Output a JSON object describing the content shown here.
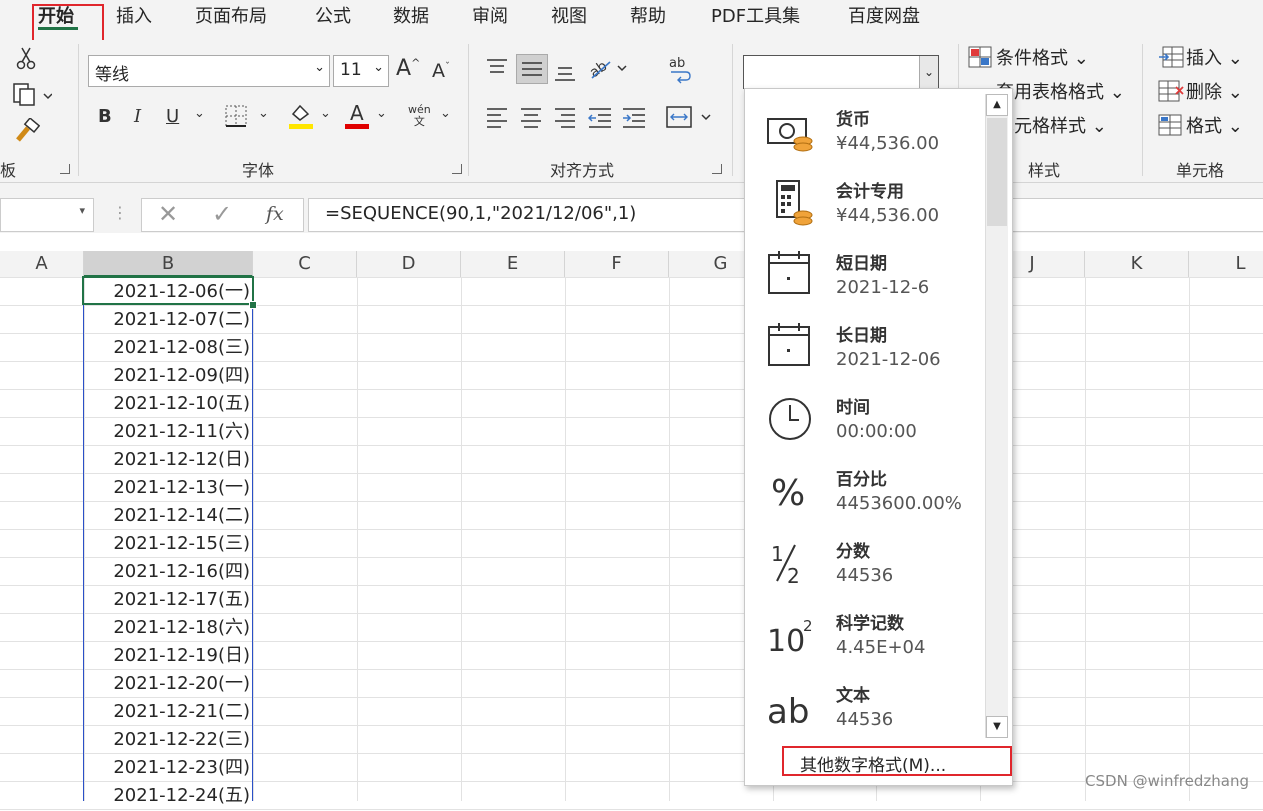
{
  "tabs": [
    "开始",
    "插入",
    "页面布局",
    "公式",
    "数据",
    "审阅",
    "视图",
    "帮助",
    "PDF工具集",
    "百度网盘"
  ],
  "ribbon": {
    "font_name": "等线",
    "font_size": "11",
    "clipboard_label": "板",
    "font_group_label": "字体",
    "align_group_label": "对齐方式",
    "styles_group_label": "样式",
    "cells_group_label": "单元格",
    "conditional_format": "条件格式",
    "table_format": "套用表格格式",
    "cell_style": "单元格样式",
    "insert": "插入",
    "delete": "删除",
    "format": "格式",
    "number_format_value": ""
  },
  "formula_bar": {
    "formula": "=SEQUENCE(90,1,\"2021/12/06\",1)",
    "fx": "fx"
  },
  "columns": [
    "A",
    "B",
    "C",
    "D",
    "E",
    "F",
    "G",
    "J",
    "K",
    "L"
  ],
  "cells": [
    "2021-12-06(一)",
    "2021-12-07(二)",
    "2021-12-08(三)",
    "2021-12-09(四)",
    "2021-12-10(五)",
    "2021-12-11(六)",
    "2021-12-12(日)",
    "2021-12-13(一)",
    "2021-12-14(二)",
    "2021-12-15(三)",
    "2021-12-16(四)",
    "2021-12-17(五)",
    "2021-12-18(六)",
    "2021-12-19(日)",
    "2021-12-20(一)",
    "2021-12-21(二)",
    "2021-12-22(三)",
    "2021-12-23(四)",
    "2021-12-24(五)"
  ],
  "number_format_menu": {
    "items": [
      {
        "name": "货币",
        "value": "¥44,536.00",
        "icon": "currency-icon"
      },
      {
        "name": "会计专用",
        "value": " ¥44,536.00",
        "icon": "accounting-icon"
      },
      {
        "name": "短日期",
        "value": "2021-12-6",
        "icon": "calendar-icon"
      },
      {
        "name": "长日期",
        "value": "2021-12-06",
        "icon": "calendar-icon"
      },
      {
        "name": "时间",
        "value": "00:00:00",
        "icon": "clock-icon"
      },
      {
        "name": "百分比",
        "value": "4453600.00%",
        "icon": "percent-icon"
      },
      {
        "name": "分数",
        "value": "44536",
        "icon": "fraction-icon"
      },
      {
        "name": "科学记数",
        "value": "4.45E+04",
        "icon": "scientific-icon"
      },
      {
        "name": "文本",
        "value": "44536",
        "icon": "text-icon"
      }
    ],
    "more_formats": "其他数字格式(M)..."
  },
  "watermark": "CSDN @winfredzhang",
  "colors": {
    "accent": "#217346",
    "highlight": "#e0262c",
    "selection": "#2a50c8"
  }
}
